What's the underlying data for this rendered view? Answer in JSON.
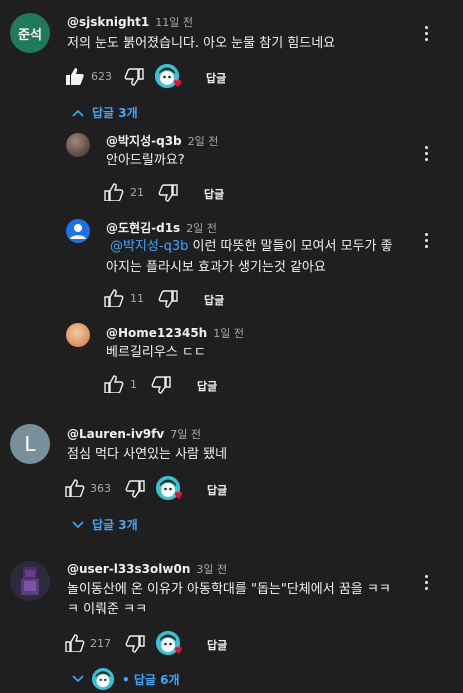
{
  "reply_label": "답글",
  "comments": [
    {
      "avatar_text": "준석",
      "avatar_color": "#1e7a5a",
      "handle": "@sjsknight1",
      "time": "11일 전",
      "text": "저의 눈도 붉어졌습니다. 아오 눈물 참기 힘드네요",
      "likes": "623",
      "replies_label": "답글 3개"
    },
    {
      "handle": "@박지성-q3b",
      "time": "2일 전",
      "text": "안아드릴까요?",
      "likes": "21"
    },
    {
      "handle": "@도현김-d1s",
      "time": "2일 전",
      "mention": "@박지성-q3b",
      "text_line1": " 이런 따뜻한 말들이 모여서 모두가 좋",
      "text_line2": "아지는 플라시보 효과가 생기는것 같아요",
      "likes": "11"
    },
    {
      "handle": "@Home12345h",
      "time": "1일 전",
      "text": "베르길리우스 ㄷㄷ",
      "likes": "1"
    },
    {
      "avatar_text": "L",
      "avatar_color": "#78909c",
      "handle": "@Lauren-iv9fv",
      "time": "7일 전",
      "text": "점심 먹다 사연있는 사람 됐네",
      "likes": "363",
      "replies_label": "답글 3개"
    },
    {
      "handle": "@user-l33s3olw0n",
      "time": "3일 전",
      "text_line1": "놀이동산에 온 이유가 아동학대를 \"돕는\"단체에서 꿈을 ㅋㅋ",
      "text_line2": "ㅋ 이뤄준 ㅋㅋ",
      "likes": "217",
      "replies_label": "• 답글 6개"
    }
  ]
}
